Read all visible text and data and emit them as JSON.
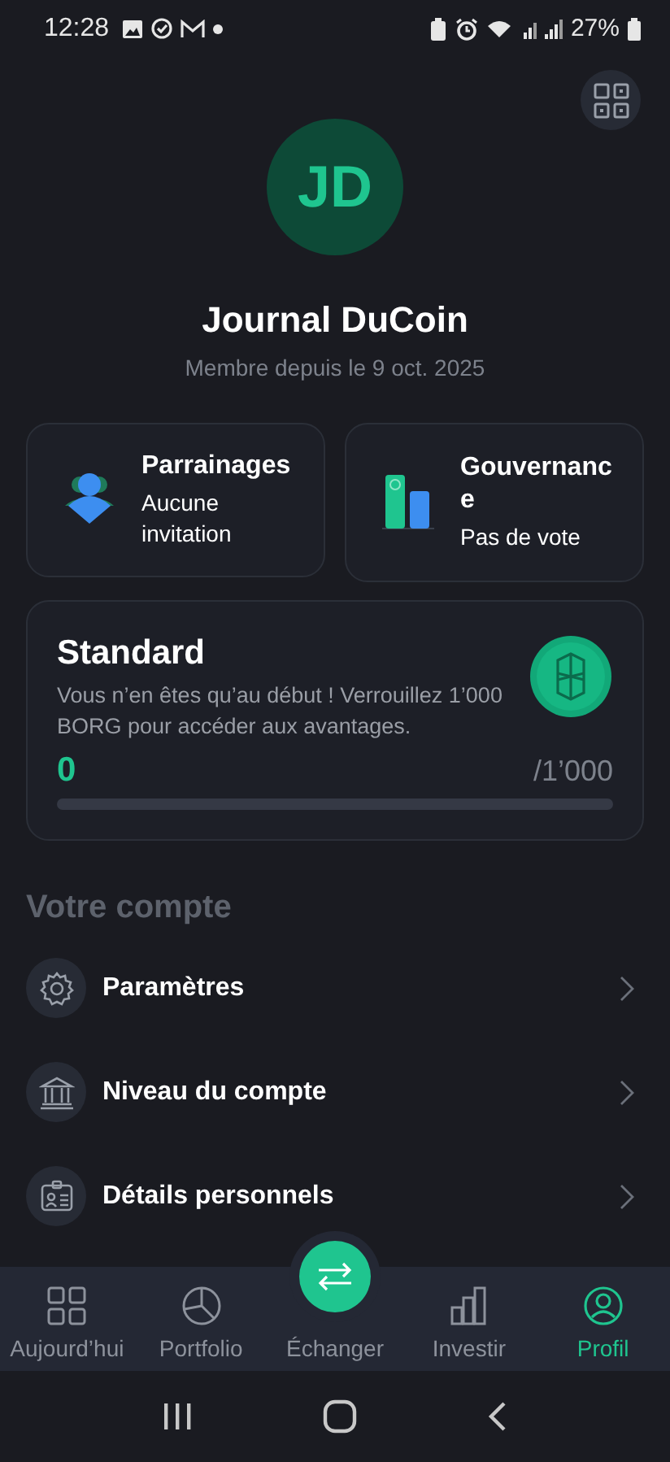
{
  "status_bar": {
    "time": "12:28",
    "battery": "27%"
  },
  "profile": {
    "initials": "JD",
    "name": "Journal DuCoin",
    "since": "Membre depuis le 9 oct. 2025"
  },
  "cards": [
    {
      "kind": "referral",
      "title": "Parrainages",
      "subtitle": "Aucune invitation"
    },
    {
      "kind": "governance",
      "title": "Gouvernance",
      "subtitle": "Pas de vote"
    }
  ],
  "tier": {
    "title": "Standard",
    "description": "Vous n’en êtes qu’au début ! Verrouillez 1’000 BORG pour accéder aux avantages.",
    "amount": "0",
    "target": "/1’000",
    "level": 0
  },
  "section_title": "Votre compte",
  "menu": [
    {
      "kind": "settings",
      "label": "Paramètres"
    },
    {
      "kind": "bank",
      "label": "Niveau du compte"
    },
    {
      "kind": "id",
      "label": "Détails personnels"
    }
  ],
  "nav": [
    {
      "kind": "grid",
      "label": "Aujourd’hui",
      "selected": false
    },
    {
      "kind": "pie",
      "label": "Portfolio",
      "selected": false
    },
    {
      "kind": "swap",
      "label": "Échanger",
      "selected": false
    },
    {
      "kind": "bars",
      "label": "Investir",
      "selected": false
    },
    {
      "kind": "user",
      "label": "Profil",
      "selected": true
    }
  ]
}
